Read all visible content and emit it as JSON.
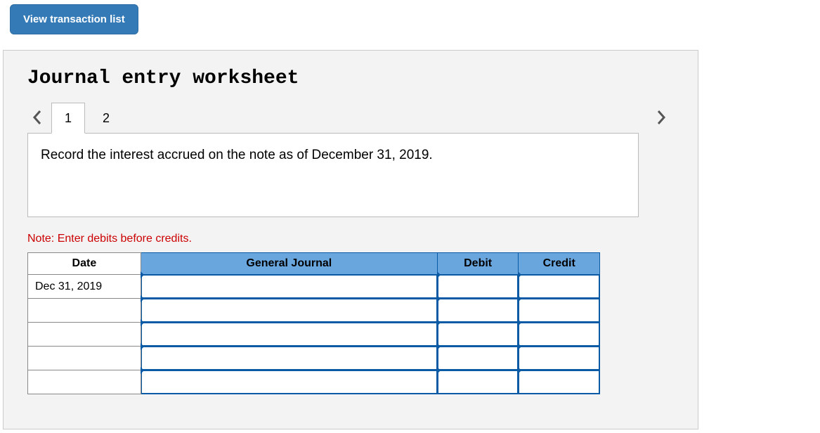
{
  "button": {
    "view_transaction_list": "View transaction list"
  },
  "worksheet": {
    "title": "Journal entry worksheet",
    "tabs": [
      "1",
      "2"
    ],
    "active_tab": 0,
    "instruction": "Record the interest accrued on the note as of December 31, 2019.",
    "note": "Note: Enter debits before credits.",
    "columns": {
      "date": "Date",
      "general_journal": "General Journal",
      "debit": "Debit",
      "credit": "Credit"
    },
    "rows": [
      {
        "date": "Dec 31, 2019",
        "general_journal": "",
        "debit": "",
        "credit": ""
      },
      {
        "date": "",
        "general_journal": "",
        "debit": "",
        "credit": ""
      },
      {
        "date": "",
        "general_journal": "",
        "debit": "",
        "credit": ""
      },
      {
        "date": "",
        "general_journal": "",
        "debit": "",
        "credit": ""
      },
      {
        "date": "",
        "general_journal": "",
        "debit": "",
        "credit": ""
      }
    ]
  }
}
